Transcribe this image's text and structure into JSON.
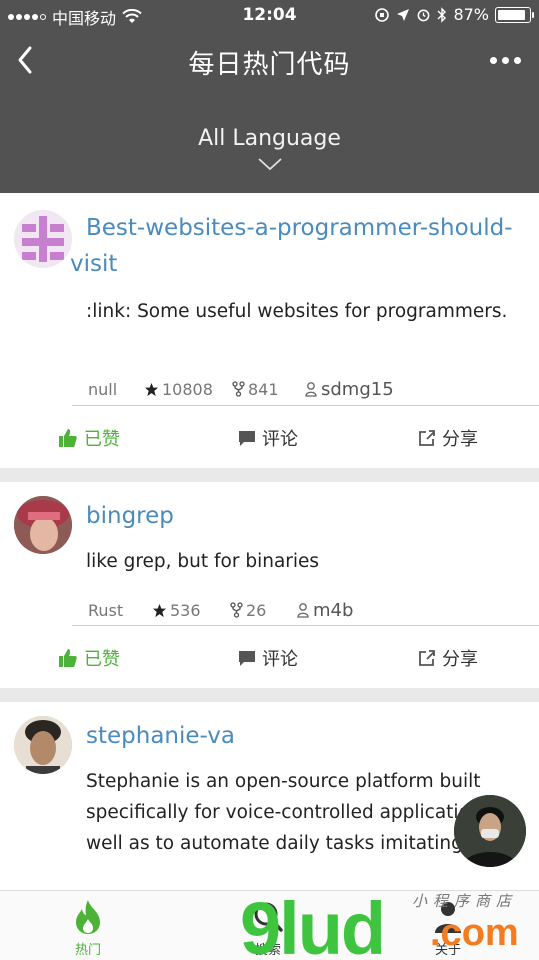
{
  "status_bar": {
    "carrier": "中国移动",
    "time": "12:04",
    "battery": "87%"
  },
  "nav": {
    "title": "每日热门代码"
  },
  "language": {
    "label": "All Language"
  },
  "repos": [
    {
      "name": "Best-websites-a-programmer-should-visit",
      "description": ":link: Some useful websites for programmers.",
      "language": "null",
      "stars": "10808",
      "forks": "841",
      "author": "sdmg15"
    },
    {
      "name": "bingrep",
      "description": "like grep, but for binaries",
      "language": "Rust",
      "stars": "536",
      "forks": "26",
      "author": "m4b"
    },
    {
      "name": "stephanie-va",
      "description": "Stephanie is an open-source platform built specifically for voice-controlled applications as well as to automate daily tasks imitating"
    }
  ],
  "actions": {
    "liked": "已赞",
    "comment": "评论",
    "share": "分享"
  },
  "tabs": {
    "hot": "热门",
    "search": "搜索",
    "about": "关于"
  },
  "watermark": {
    "main": "9lud",
    "suffix": ".com",
    "script": "小程序商店"
  },
  "colors": {
    "header_bg": "#525252",
    "link": "#4a8bbd",
    "liked": "#4cb338"
  }
}
